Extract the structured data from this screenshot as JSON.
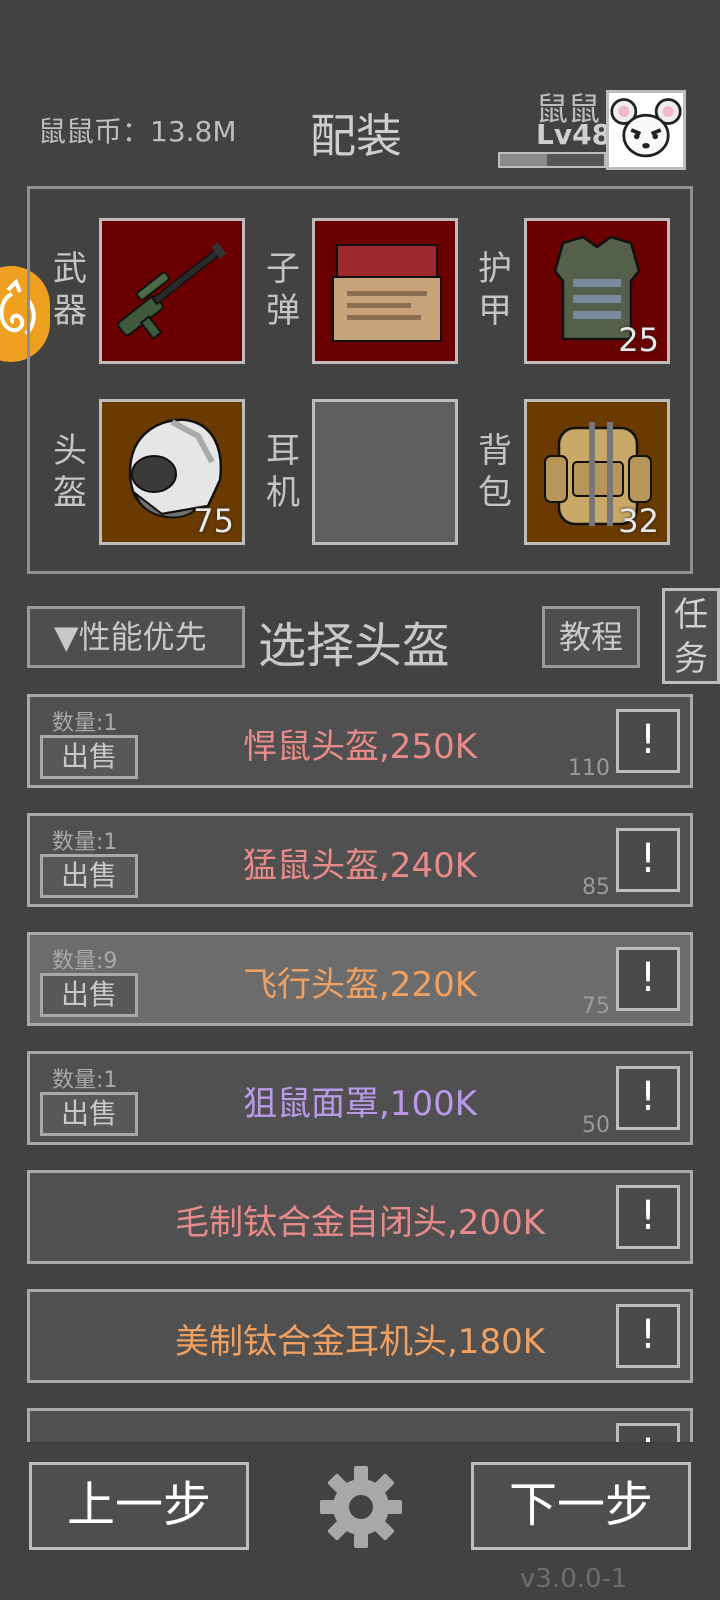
{
  "header": {
    "currency": "鼠鼠币：13.8M",
    "title": "配装",
    "player_name": "鼠鼠",
    "player_level": "Lv48",
    "xp_fraction": 0.45
  },
  "equipment": {
    "slots": [
      {
        "label": "武器",
        "item": "sniper-rifle",
        "count": ""
      },
      {
        "label": "子弹",
        "item": "ammo-box",
        "count": ""
      },
      {
        "label": "护甲",
        "item": "body-armor",
        "count": "25"
      },
      {
        "label": "头盔",
        "item": "flight-helmet",
        "count": "75"
      },
      {
        "label": "耳机",
        "item": "",
        "count": ""
      },
      {
        "label": "背包",
        "item": "backpack",
        "count": "32"
      }
    ]
  },
  "select_bar": {
    "sort_label": "▼性能优先",
    "title": "选择头盔",
    "tutorial_label": "教程",
    "task_label": "任务"
  },
  "helmet_list": [
    {
      "qty": "数量:1",
      "sell": "出售",
      "name": "悍鼠头盔,250K",
      "score": "110",
      "info": "!",
      "color": "#e88a8a"
    },
    {
      "qty": "数量:1",
      "sell": "出售",
      "name": "猛鼠头盔,240K",
      "score": "85",
      "info": "!",
      "color": "#e88a8a"
    },
    {
      "qty": "数量:9",
      "sell": "出售",
      "name": "飞行头盔,220K",
      "score": "75",
      "info": "!",
      "color": "#f0a060"
    },
    {
      "qty": "数量:1",
      "sell": "出售",
      "name": "狙鼠面罩,100K",
      "score": "50",
      "info": "!",
      "color": "#b89ae8"
    },
    {
      "qty": "",
      "sell": "",
      "name": "毛制钛合金自闭头,200K",
      "score": "",
      "info": "!",
      "color": "#e88a8a"
    },
    {
      "qty": "",
      "sell": "",
      "name": "美制钛合金耳机头,180K",
      "score": "",
      "info": "!",
      "color": "#f0a060"
    },
    {
      "qty": "",
      "sell": "",
      "name": "",
      "score": "",
      "info": "!",
      "color": "#e88a8a"
    }
  ],
  "footer": {
    "prev_label": "上一步",
    "next_label": "下一步",
    "version": "v3.0.0-1"
  }
}
